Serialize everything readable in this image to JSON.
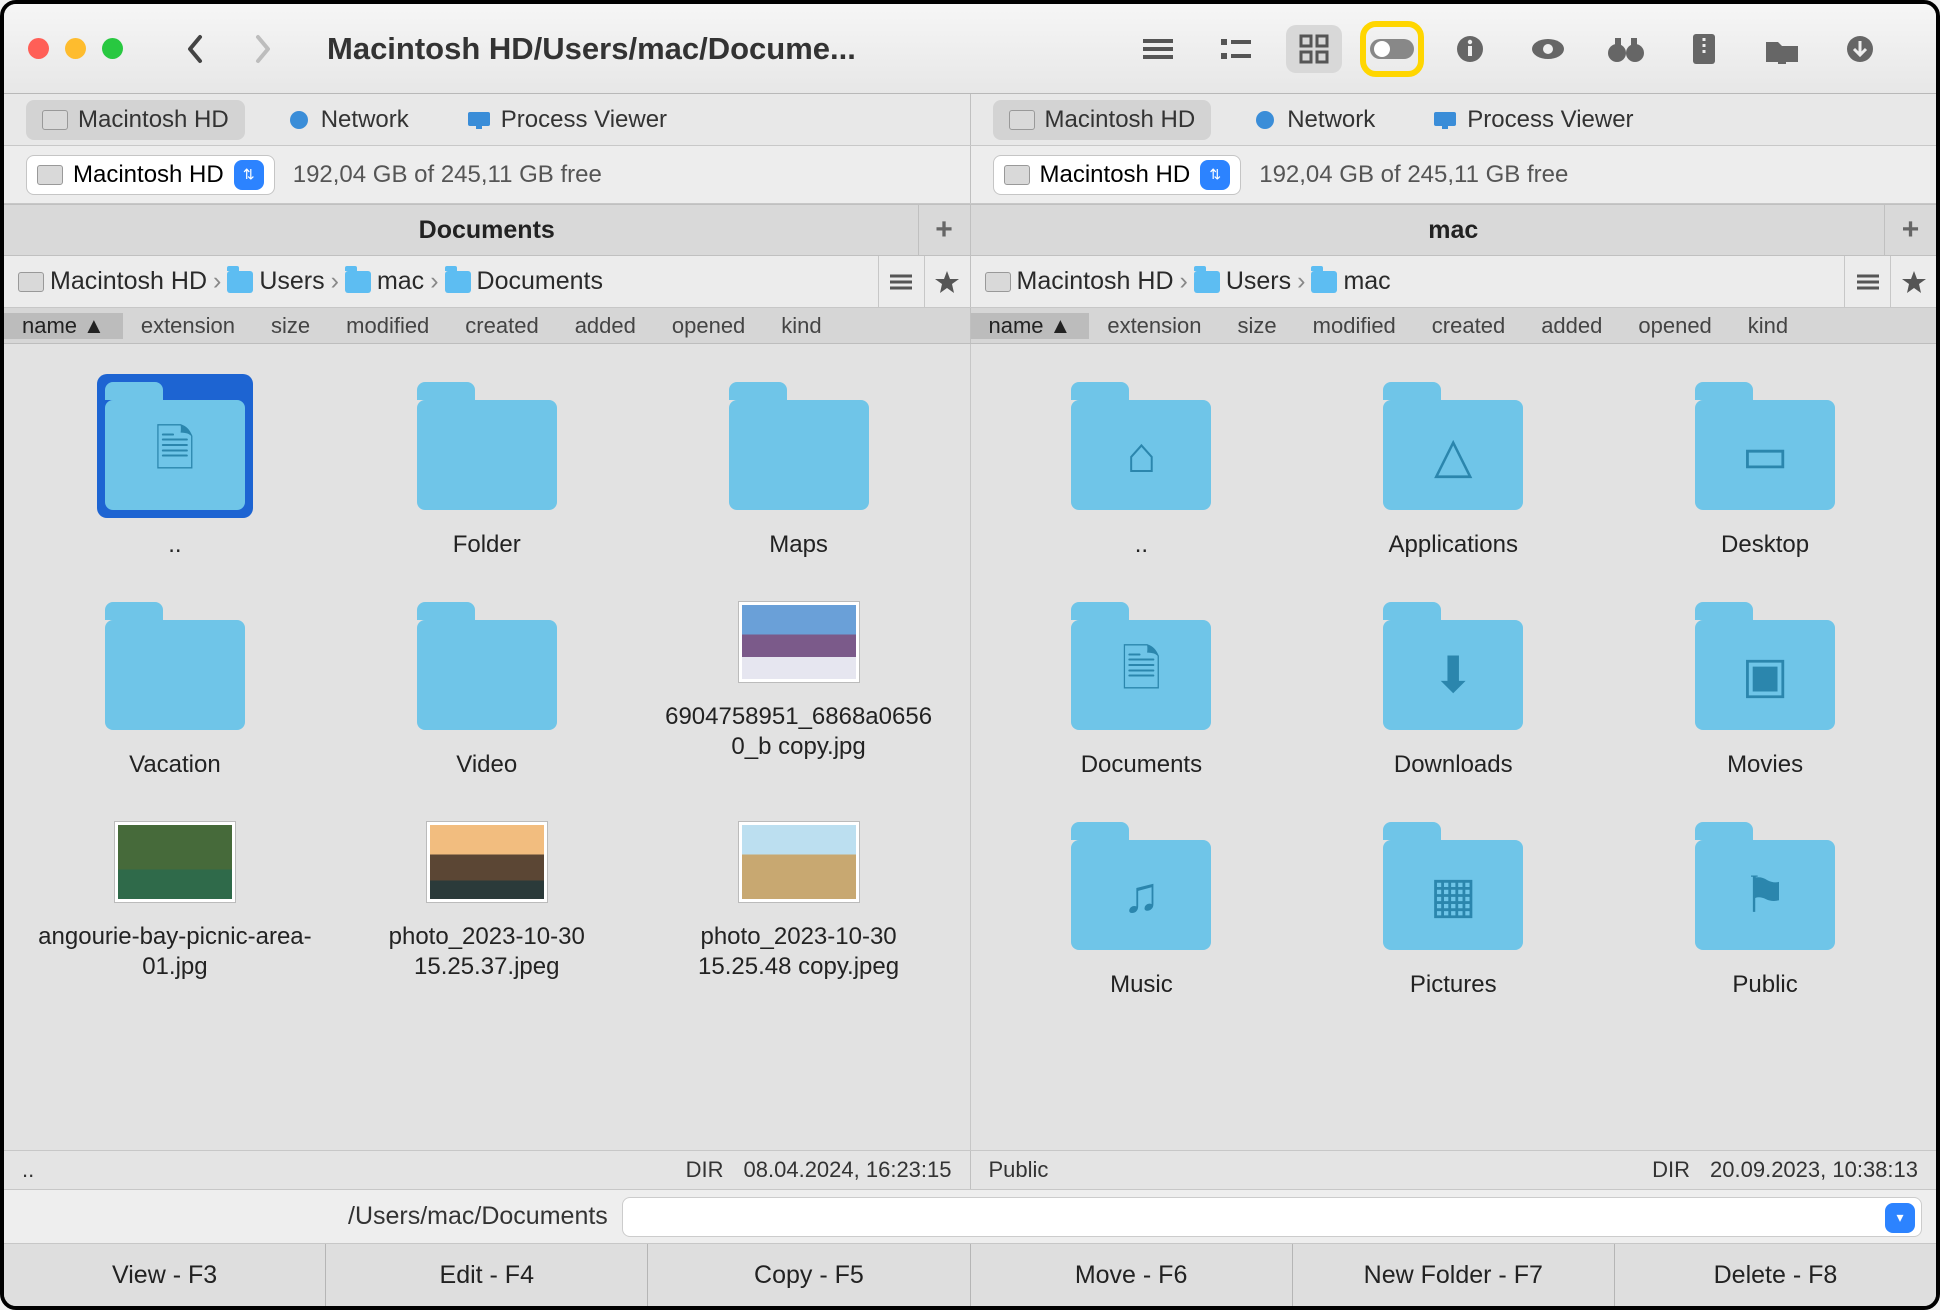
{
  "title": "Macintosh HD/Users/mac/Docume...",
  "toolbar": {
    "view_list": "list",
    "view_columns": "columns",
    "view_icons": "icons",
    "toggle": "toggle",
    "info": "info",
    "preview": "preview",
    "binoculars": "binoculars",
    "archive": "archive",
    "network": "network",
    "download": "download"
  },
  "panes": {
    "left": {
      "tabs": [
        {
          "label": "Macintosh HD",
          "active": true,
          "icon": "hdd"
        },
        {
          "label": "Network",
          "active": false,
          "icon": "globe"
        },
        {
          "label": "Process Viewer",
          "active": false,
          "icon": "monitor"
        }
      ],
      "volume": {
        "name": "Macintosh HD",
        "free": "192,04 GB of 245,11 GB free"
      },
      "title": "Documents",
      "breadcrumb": [
        {
          "label": "Macintosh HD",
          "icon": "hdd"
        },
        {
          "label": "Users",
          "icon": "folder"
        },
        {
          "label": "mac",
          "icon": "folder"
        },
        {
          "label": "Documents",
          "icon": "folder"
        }
      ],
      "items": [
        {
          "label": "..",
          "type": "folder-doc",
          "selected": true
        },
        {
          "label": "Folder",
          "type": "folder"
        },
        {
          "label": "Maps",
          "type": "folder"
        },
        {
          "label": "Vacation",
          "type": "folder"
        },
        {
          "label": "Video",
          "type": "folder"
        },
        {
          "label": "6904758951_6868a06560_b copy.jpg",
          "type": "image-mountain"
        },
        {
          "label": "angourie-bay-picnic-area-01.jpg",
          "type": "image-green"
        },
        {
          "label": "photo_2023-10-30 15.25.37.jpeg",
          "type": "image-sunset"
        },
        {
          "label": "photo_2023-10-30 15.25.48 copy.jpeg",
          "type": "image-beach"
        }
      ],
      "status": {
        "name": "..",
        "dir": "DIR",
        "date": "08.04.2024, 16:23:15"
      }
    },
    "right": {
      "tabs": [
        {
          "label": "Macintosh HD",
          "active": true,
          "icon": "hdd"
        },
        {
          "label": "Network",
          "active": false,
          "icon": "globe"
        },
        {
          "label": "Process Viewer",
          "active": false,
          "icon": "monitor"
        }
      ],
      "volume": {
        "name": "Macintosh HD",
        "free": "192,04 GB of 245,11 GB free"
      },
      "title": "mac",
      "breadcrumb": [
        {
          "label": "Macintosh HD",
          "icon": "hdd"
        },
        {
          "label": "Users",
          "icon": "folder"
        },
        {
          "label": "mac",
          "icon": "folder"
        }
      ],
      "items": [
        {
          "label": "..",
          "type": "folder-home"
        },
        {
          "label": "Applications",
          "type": "folder-app"
        },
        {
          "label": "Desktop",
          "type": "folder-desktop"
        },
        {
          "label": "Documents",
          "type": "folder-doc"
        },
        {
          "label": "Downloads",
          "type": "folder-download"
        },
        {
          "label": "Movies",
          "type": "folder-movie"
        },
        {
          "label": "Music",
          "type": "folder-music"
        },
        {
          "label": "Pictures",
          "type": "folder-picture"
        },
        {
          "label": "Public",
          "type": "folder-public"
        }
      ],
      "status": {
        "name": "Public",
        "dir": "DIR",
        "date": "20.09.2023, 10:38:13"
      }
    }
  },
  "columns": [
    "name",
    "extension",
    "size",
    "modified",
    "created",
    "added",
    "opened",
    "kind"
  ],
  "path_label": "/Users/mac/Documents",
  "fn_buttons": [
    "View - F3",
    "Edit - F4",
    "Copy - F5",
    "Move - F6",
    "New Folder - F7",
    "Delete - F8"
  ]
}
